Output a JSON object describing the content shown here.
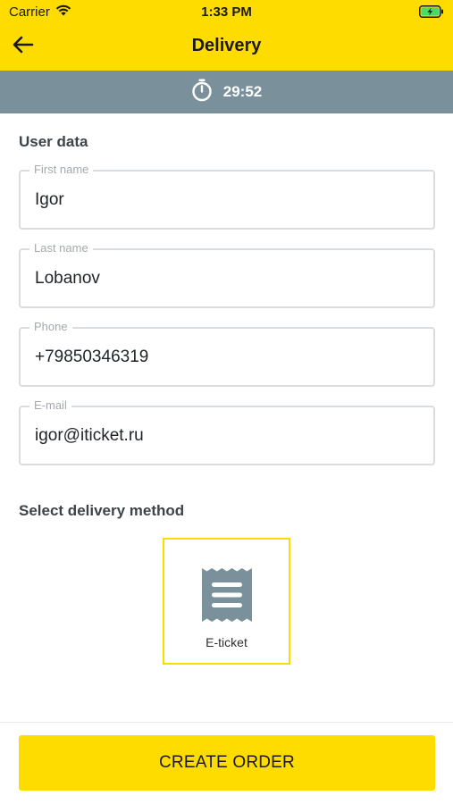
{
  "status_bar": {
    "carrier": "Carrier",
    "time": "1:33 PM"
  },
  "header": {
    "title": "Delivery"
  },
  "timer": {
    "value": "29:52"
  },
  "user_data": {
    "section_title": "User data",
    "fields": [
      {
        "label": "First name",
        "value": "Igor"
      },
      {
        "label": "Last name",
        "value": "Lobanov"
      },
      {
        "label": "Phone",
        "value": "+79850346319"
      },
      {
        "label": "E-mail",
        "value": "igor@iticket.ru"
      }
    ]
  },
  "delivery": {
    "section_title": "Select delivery method",
    "methods": [
      {
        "label": "E-ticket",
        "icon": "receipt-icon",
        "selected": true
      }
    ]
  },
  "footer": {
    "create_order_label": "CREATE ORDER"
  },
  "colors": {
    "accent": "#ffdc00",
    "timer_bar": "#7a919c",
    "field_border": "#d9dde0"
  }
}
